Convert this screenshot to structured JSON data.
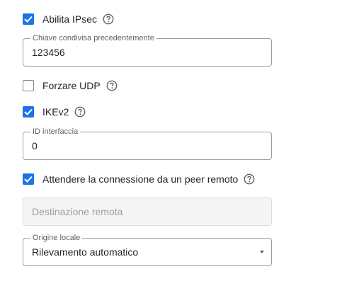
{
  "ipsec": {
    "label": "Abilita IPsec",
    "checked": true
  },
  "psk": {
    "label": "Chiave condivisa precedentemente",
    "value": "123456"
  },
  "force_udp": {
    "label": "Forzare UDP",
    "checked": false
  },
  "ikev2": {
    "label": "IKEv2",
    "checked": true
  },
  "interface_id": {
    "label": "ID interfaccia",
    "value": "0"
  },
  "wait_peer": {
    "label": "Attendere la connessione da un peer remoto",
    "checked": true
  },
  "remote_dest": {
    "placeholder": "Destinazione remota"
  },
  "local_origin": {
    "label": "Origine locale",
    "value": "Rilevamento automatico",
    "icon": "dropdown-caret-icon"
  },
  "colors": {
    "accent": "#1a73e8",
    "border": "#9e9e9e",
    "disabled_bg": "#f5f5f5"
  }
}
